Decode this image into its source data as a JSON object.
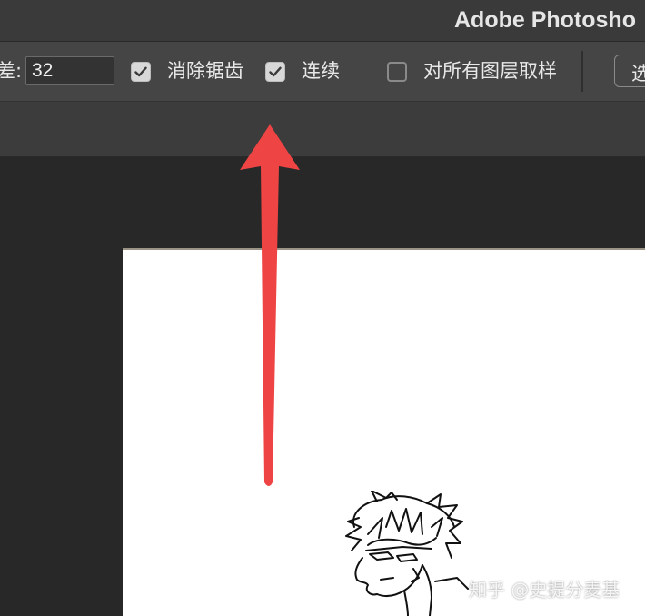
{
  "app": {
    "title": "Adobe Photosho"
  },
  "options_bar": {
    "tolerance_label": "差:",
    "tolerance_value": "32",
    "anti_alias": {
      "label": "消除锯齿",
      "checked": true
    },
    "contiguous": {
      "label": "连续",
      "checked": true
    },
    "sample_all_layers": {
      "label": "对所有图层取样",
      "checked": false
    },
    "select_button_label": "选"
  },
  "watermark": "知乎 @史提分麦基",
  "colors": {
    "arrow": "#ee4444",
    "toolbar_bg": "#454545",
    "canvas_bg": "#ffffff",
    "workspace_bg": "#282828"
  },
  "icons": {
    "checkbox_checked": "checkmark-icon"
  }
}
